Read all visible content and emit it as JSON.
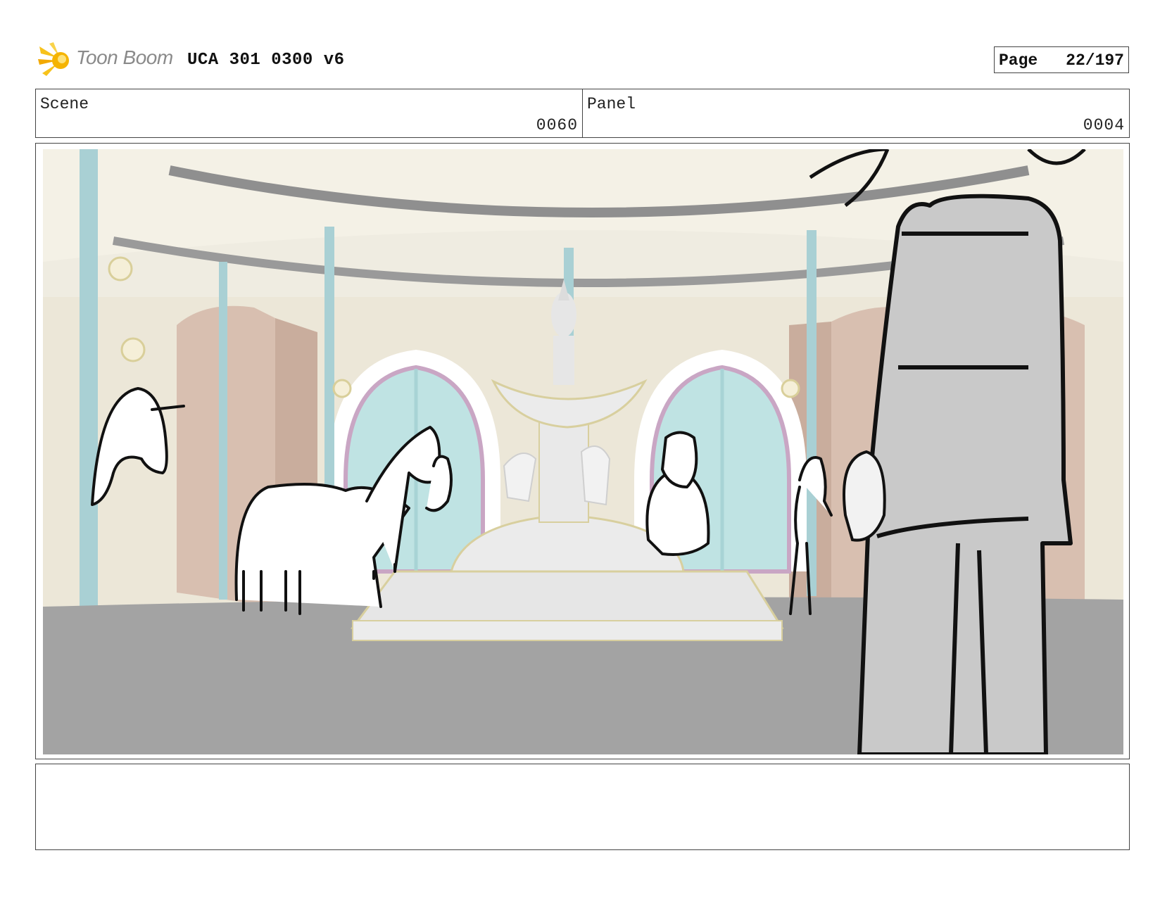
{
  "header": {
    "logo_text": "Toon Boom",
    "title": "UCA 301 0300 v6",
    "page_label": "Page",
    "page_value": "22/197"
  },
  "scene": {
    "label": "Scene",
    "value": "0060"
  },
  "panel": {
    "label": "Panel",
    "value": "0004"
  },
  "artwork": {
    "description_icon": "storyboard-drawing",
    "colors": {
      "wall": "#ede9dc",
      "floor": "#a3a3a3",
      "window": "#bfe3e3",
      "pillar": "#a9d0d4",
      "door": "#d9c0b0",
      "figure": "#c9c9c9",
      "logo_flare": "#f2b705"
    }
  },
  "notes": {
    "text": ""
  }
}
